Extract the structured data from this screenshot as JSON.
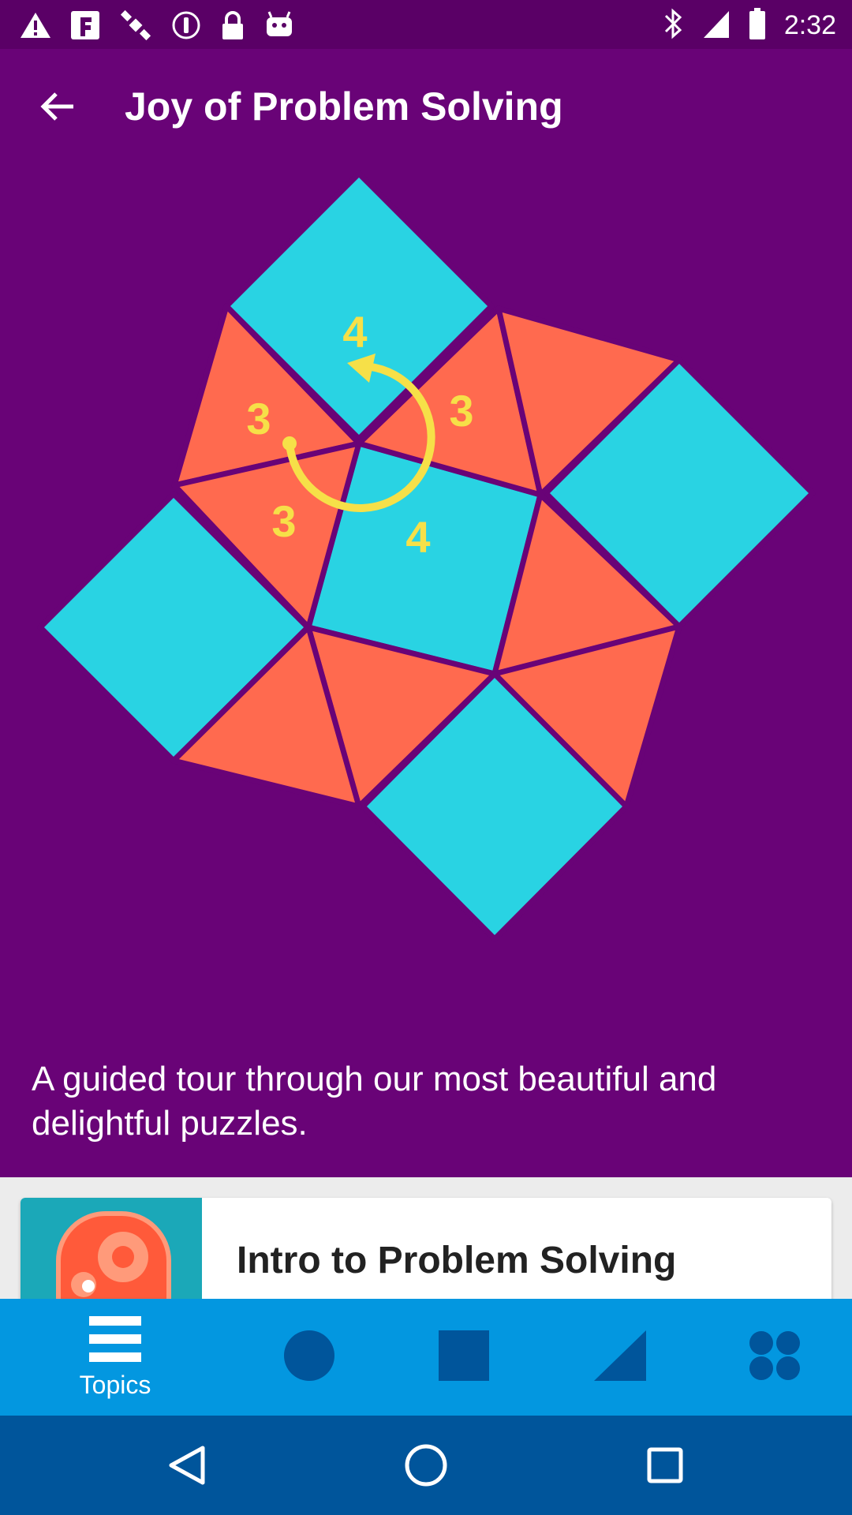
{
  "status_bar": {
    "time": "2:32",
    "left_icons": [
      "warning-icon",
      "fake-gps-icon",
      "satellite-icon",
      "download-icon",
      "lock-icon",
      "android-icon"
    ],
    "right_icons": [
      "bluetooth-icon"
    ]
  },
  "app_bar": {
    "title": "Joy of Problem Solving",
    "back_icon": "arrow-back-icon"
  },
  "hero": {
    "description": "A guided tour through our most beautiful and delightful puzzles.",
    "labels": {
      "top_4": "4",
      "left_3": "3",
      "right_3": "3",
      "bottom_3": "3",
      "bottom_4": "4"
    },
    "colors": {
      "background": "#690377",
      "square": "#29d3e3",
      "triangle": "#ff6a4f",
      "annotation": "#f6e048"
    }
  },
  "course_card": {
    "title": "Intro to Problem Solving",
    "thumb_icon": "gears-icon"
  },
  "bottom_nav": {
    "items": [
      {
        "label": "Topics",
        "icon": "hamburger-icon",
        "active": true
      },
      {
        "label": "",
        "icon": "circle-icon"
      },
      {
        "label": "",
        "icon": "square-icon"
      },
      {
        "label": "",
        "icon": "triangle-icon"
      },
      {
        "label": "",
        "icon": "four-dots-icon"
      }
    ],
    "colors": {
      "bar": "#0397e0",
      "active_icon": "#ffffff",
      "inactive_icon": "#00559b"
    }
  },
  "system_nav": {
    "buttons": [
      "back-triangle-icon",
      "home-circle-icon",
      "recents-square-icon"
    ]
  }
}
